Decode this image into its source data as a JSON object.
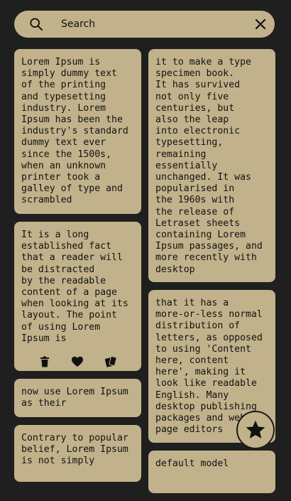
{
  "search": {
    "placeholder": "Search"
  },
  "notes": {
    "n1": "Lorem Ipsum is\nsimply dummy text\nof the printing\nand typesetting\nindustry. Lorem\nIpsum has been the\nindustry's standard\ndummy text ever\nsince the 1500s,\nwhen an unknown\nprinter took a\ngalley of type and\nscrambled",
    "n2": "It is a long\nestablished fact\nthat a reader will\nbe distracted\nby the readable\ncontent of a page\nwhen looking at its\nlayout. The point\nof using Lorem\nIpsum is",
    "n3": "now use Lorem Ipsum\nas their",
    "n4": "Contrary to popular\nbelief, Lorem Ipsum\nis not simply",
    "n5": "it to make a type\nspecimen book.\nIt has survived\nnot only five\ncenturies, but\nalso the leap\ninto electronic\ntypesetting,\nremaining\nessentially\nunchanged. It was\npopularised in\nthe 1960s with\nthe release of\nLetraset sheets\ncontaining Lorem\nIpsum passages, and\nmore recently with\ndesktop",
    "n6": "that it has a\nmore-or-less normal\ndistribution of\nletters, as opposed\nto using 'Content\nhere, content\nhere', making it\nlook like readable\nEnglish. Many\ndesktop publishing\npackages and web\npage editors",
    "n7": "default model"
  },
  "icons": {
    "search": "magnifier-icon",
    "clear": "close-icon",
    "delete": "trash-icon",
    "favorite": "heart-icon",
    "copy": "cards-icon",
    "fab": "star-icon"
  },
  "colors": {
    "background": "#1f1f1f",
    "card": "#c1b28b",
    "text": "#121212"
  }
}
